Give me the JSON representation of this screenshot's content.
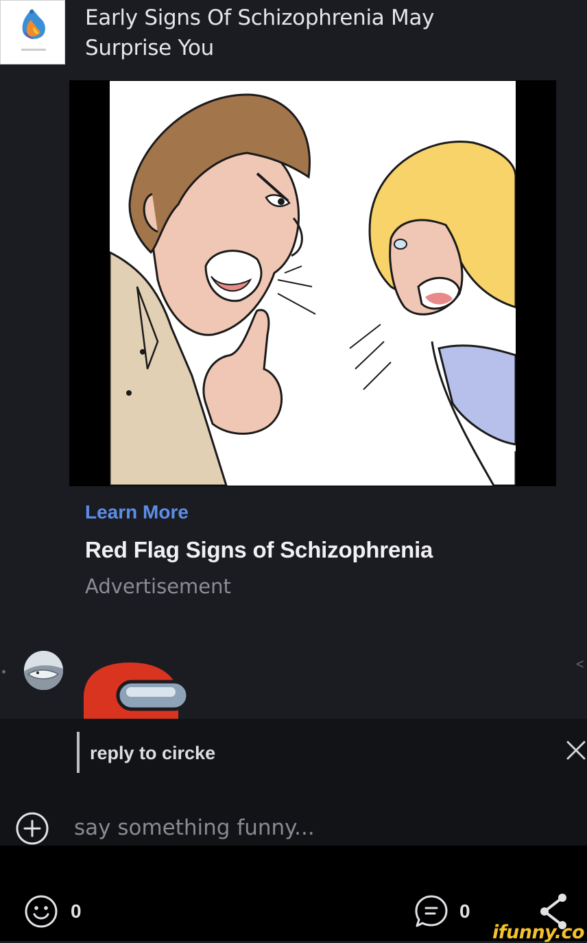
{
  "ad": {
    "headline": "Early Signs Of Schizophrenia May Surprise You",
    "cta": "Learn More",
    "title": "Red Flag Signs of Schizophrenia",
    "label": "Advertisement"
  },
  "comment": {
    "reply_to": "reply to circke"
  },
  "input": {
    "placeholder": "say something funny..."
  },
  "bottom": {
    "smile_count": "0",
    "comments_count": "0",
    "watermark": "ifunny.co"
  },
  "colors": {
    "background": "#1b1c22",
    "link": "#5c8ee8",
    "bar": "#121317",
    "watermark": "#f4c22b"
  },
  "icons": [
    "ad-logo-icon",
    "close-icon",
    "add-circle-icon",
    "smile-icon",
    "comments-icon",
    "share-icon",
    "chevron-left-icon"
  ]
}
